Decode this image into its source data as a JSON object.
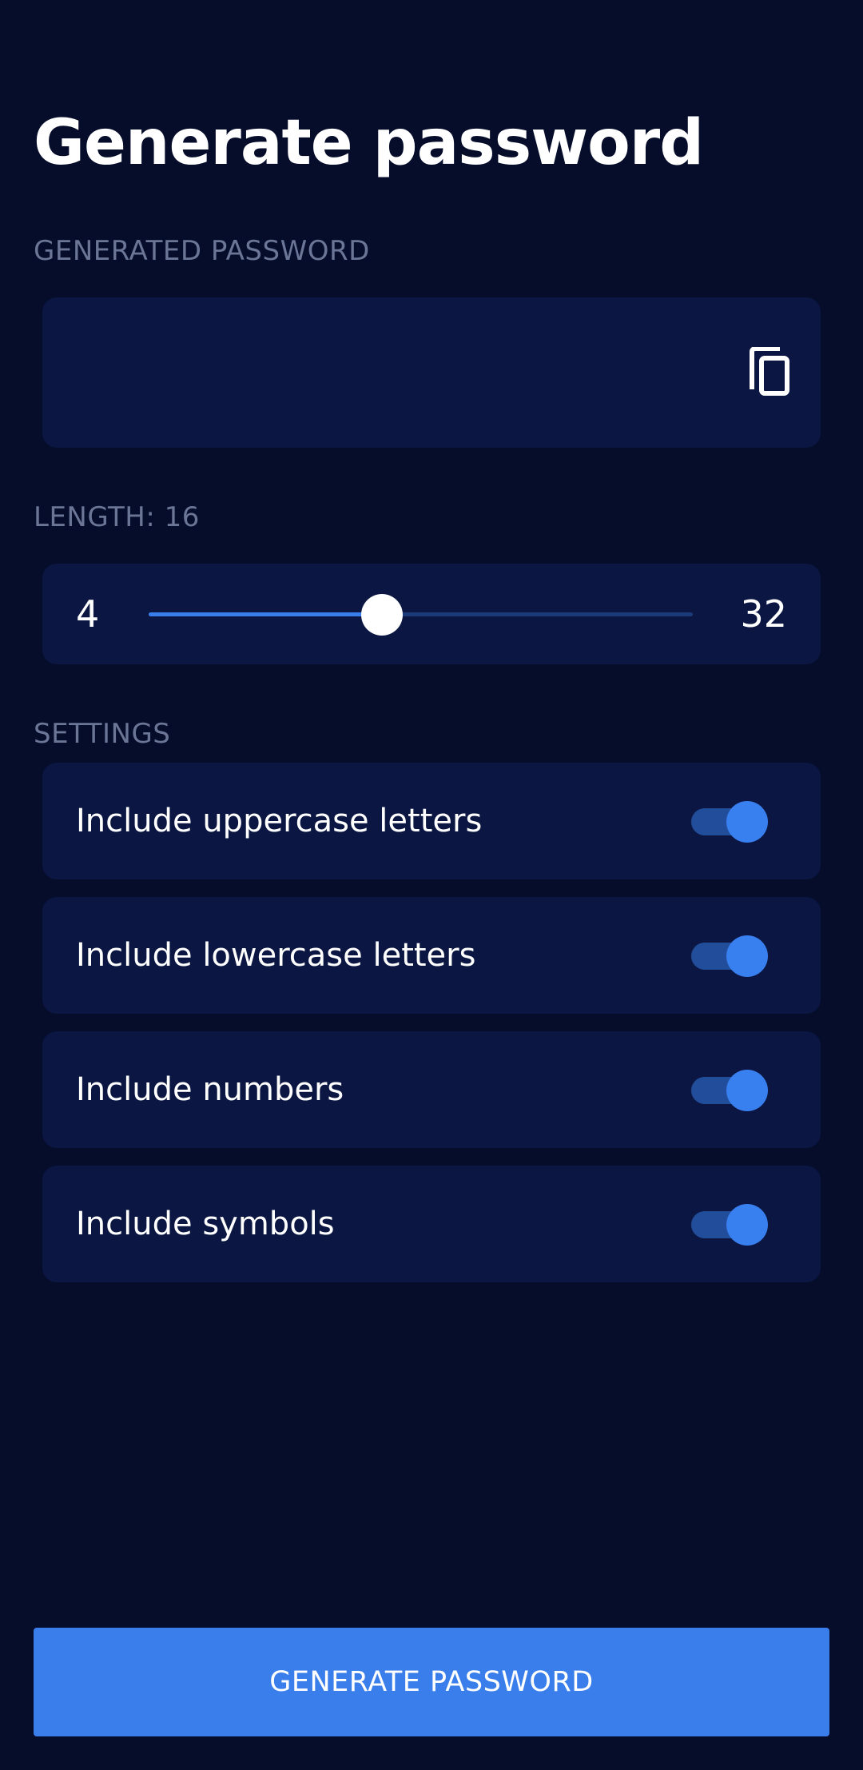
{
  "page": {
    "title": "Generate password"
  },
  "password": {
    "section_label": "GENERATED PASSWORD",
    "value": "",
    "copy_icon": "copy-icon"
  },
  "length": {
    "section_label": "LENGTH: 16",
    "value": 16,
    "min_label": "4",
    "max_label": "32",
    "min": 4,
    "max": 32
  },
  "settings": {
    "section_label": "SETTINGS",
    "items": [
      {
        "label": "Include uppercase letters",
        "enabled": true
      },
      {
        "label": "Include lowercase letters",
        "enabled": true
      },
      {
        "label": "Include numbers",
        "enabled": true
      },
      {
        "label": "Include symbols",
        "enabled": true
      }
    ]
  },
  "actions": {
    "generate_label": "GENERATE PASSWORD"
  },
  "colors": {
    "background": "#060d2b",
    "card": "#0b1742",
    "accent": "#3a7eec",
    "muted_text": "#6b7596",
    "toggle_track_on": "#224d9b"
  }
}
